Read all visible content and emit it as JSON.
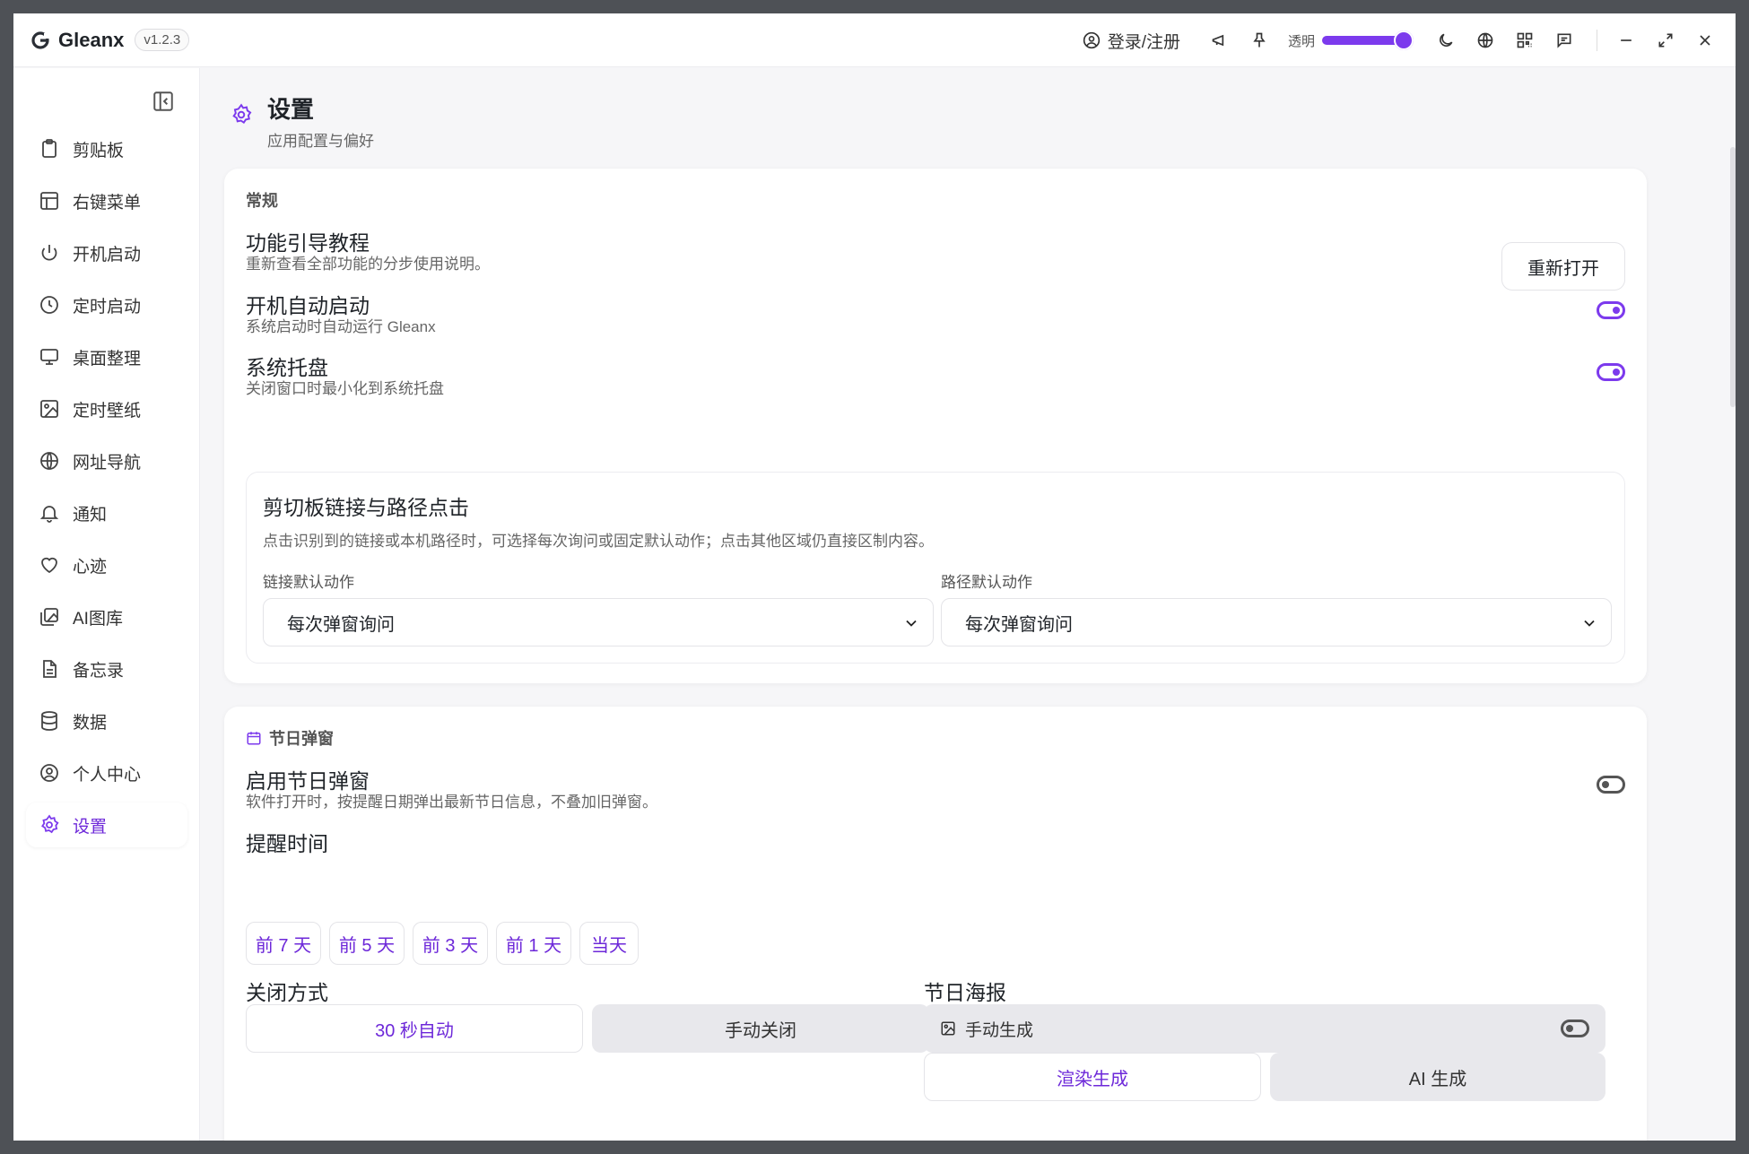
{
  "app": {
    "name": "Gleanx",
    "version": "v1.2.3"
  },
  "titlebar": {
    "login_label": "登录/注册",
    "opacity_label": "透明",
    "opacity_value": 1.0,
    "icons": [
      "user-circle-icon",
      "megaphone-icon",
      "pin-icon",
      "moon-icon",
      "globe-icon",
      "qr-code-icon",
      "message-icon",
      "minimize-icon",
      "maximize-icon",
      "close-icon"
    ]
  },
  "sidebar": {
    "items": [
      {
        "label": "剪贴板",
        "icon": "clipboard-icon"
      },
      {
        "label": "右键菜单",
        "icon": "layout-icon"
      },
      {
        "label": "开机启动",
        "icon": "power-icon"
      },
      {
        "label": "定时启动",
        "icon": "clock-icon"
      },
      {
        "label": "桌面整理",
        "icon": "monitor-icon"
      },
      {
        "label": "定时壁纸",
        "icon": "image-icon"
      },
      {
        "label": "网址导航",
        "icon": "globe-icon"
      },
      {
        "label": "通知",
        "icon": "bell-icon"
      },
      {
        "label": "心迹",
        "icon": "heart-icon"
      },
      {
        "label": "AI图库",
        "icon": "gallery-icon"
      },
      {
        "label": "备忘录",
        "icon": "file-text-icon"
      },
      {
        "label": "数据",
        "icon": "database-icon"
      },
      {
        "label": "个人中心",
        "icon": "user-circle-icon"
      },
      {
        "label": "设置",
        "icon": "gear-icon",
        "active": true
      }
    ]
  },
  "page": {
    "title": "设置",
    "subtitle": "应用配置与偏好"
  },
  "general": {
    "section_title": "常规",
    "tutorial": {
      "title": "功能引导教程",
      "desc": "重新查看全部功能的分步使用说明。",
      "button": "重新打开"
    },
    "autostart": {
      "title": "开机自动启动",
      "desc": "系统启动时自动运行 Gleanx",
      "enabled": true
    },
    "tray": {
      "title": "系统托盘",
      "desc": "关闭窗口时最小化到系统托盘",
      "enabled": true
    },
    "clipboard_links": {
      "title": "剪切板链接与路径点击",
      "desc": "点击识别到的链接或本机路径时，可选择每次询问或固定默认动作；点击其他区域仍直接区制内容。",
      "link_label": "链接默认动作",
      "link_value": "每次弹窗询问",
      "path_label": "路径默认动作",
      "path_value": "每次弹窗询问"
    }
  },
  "holiday": {
    "section_title": "节日弹窗",
    "enable": {
      "title": "启用节日弹窗",
      "desc": "软件打开时，按提醒日期弹出最新节日信息，不叠加旧弹窗。",
      "enabled": false
    },
    "remind_title": "提醒时间",
    "remind_options": [
      "前 7 天",
      "前 5 天",
      "前 3 天",
      "前 1 天",
      "当天"
    ],
    "close_title": "关闭方式",
    "close_options": [
      "30 秒自动",
      "手动关闭"
    ],
    "poster_title": "节日海报",
    "poster_mode": "手动生成",
    "poster_options": [
      "渲染生成",
      "AI 生成"
    ]
  },
  "colors": {
    "accent": "#7c3aed",
    "accent_text": "#6d28d9"
  }
}
